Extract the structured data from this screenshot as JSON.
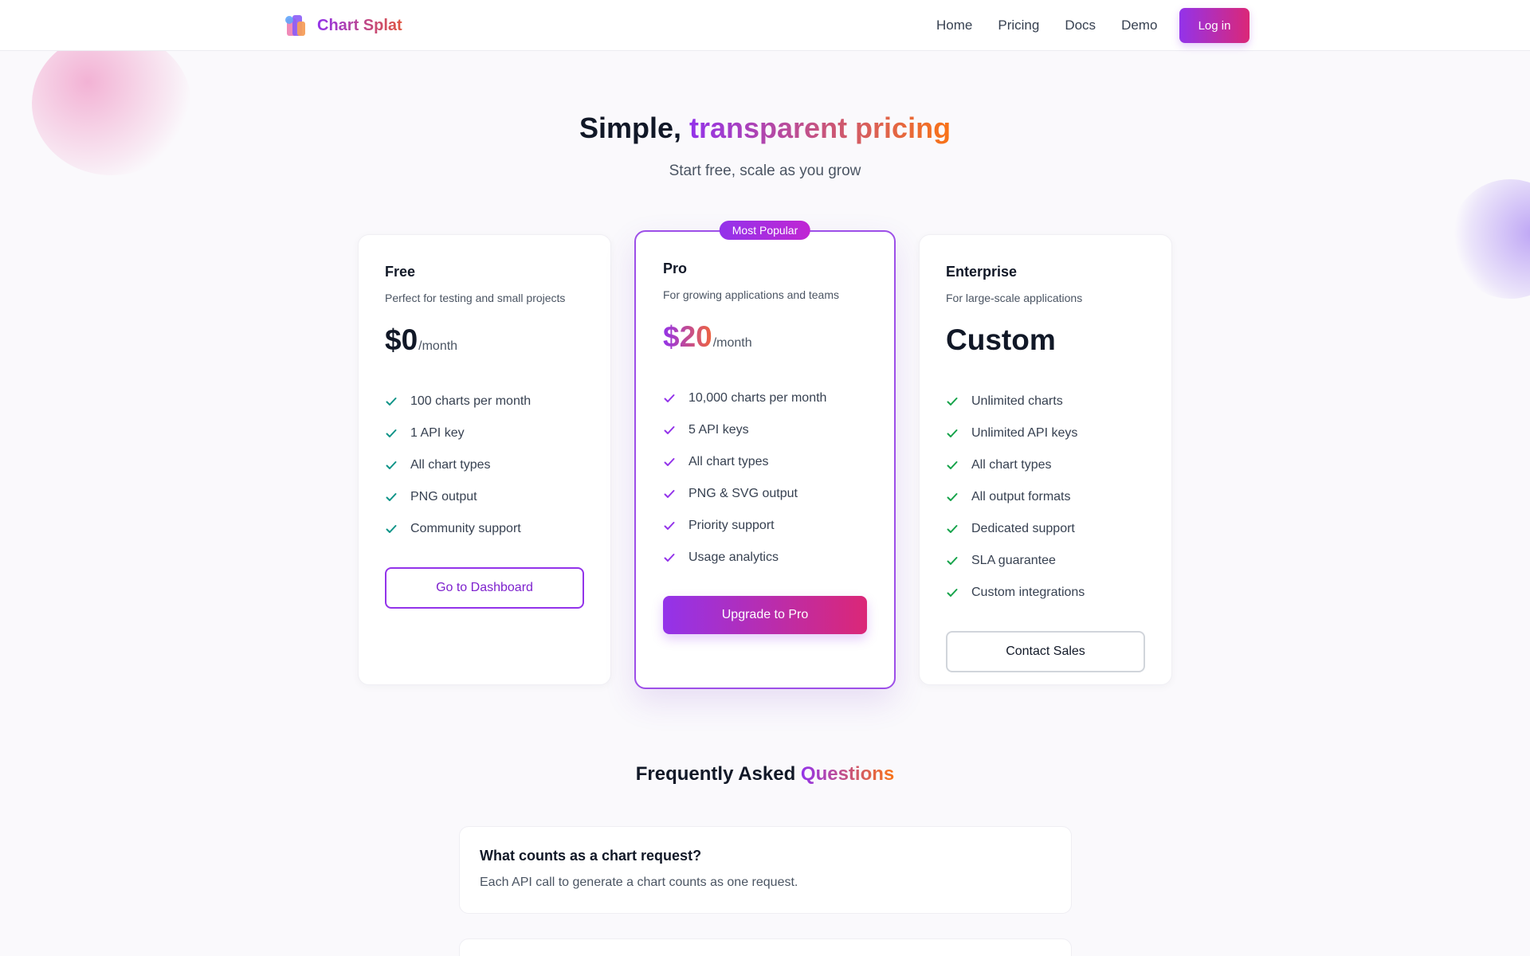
{
  "brand": {
    "name": "Chart Splat"
  },
  "nav": {
    "items": [
      "Home",
      "Pricing",
      "Docs",
      "Demo"
    ],
    "login_label": "Log in"
  },
  "hero": {
    "title_plain": "Simple,",
    "title_accent": "transparent pricing",
    "subtitle": "Start free, scale as you grow"
  },
  "plans": [
    {
      "name": "Free",
      "description": "Perfect for testing and small projects",
      "price": "$0",
      "period": "/month",
      "features": [
        "100 charts per month",
        "1 API key",
        "All chart types",
        "PNG output",
        "Community support"
      ],
      "cta": "Go to Dashboard"
    },
    {
      "badge": "Most Popular",
      "name": "Pro",
      "description": "For growing applications and teams",
      "price": "$20",
      "period": "/month",
      "features": [
        "10,000 charts per month",
        "5 API keys",
        "All chart types",
        "PNG & SVG output",
        "Priority support",
        "Usage analytics"
      ],
      "cta": "Upgrade to Pro"
    },
    {
      "name": "Enterprise",
      "description": "For large-scale applications",
      "price": "Custom",
      "features": [
        "Unlimited charts",
        "Unlimited API keys",
        "All chart types",
        "All output formats",
        "Dedicated support",
        "SLA guarantee",
        "Custom integrations"
      ],
      "cta": "Contact Sales"
    }
  ],
  "faq": {
    "title_plain": "Frequently Asked",
    "title_accent": "Questions",
    "items": [
      {
        "question": "What counts as a chart request?",
        "answer": "Each API call to generate a chart counts as one request."
      }
    ]
  },
  "colors": {
    "brand_purple": "#9333ea",
    "brand_pink": "#db2777",
    "brand_orange": "#f97316",
    "check_teal": "#0f9488",
    "check_purple": "#9333ea",
    "check_green": "#16a34a"
  },
  "icons": {
    "feature": "check-icon",
    "logo": "chart-logo-icon"
  }
}
